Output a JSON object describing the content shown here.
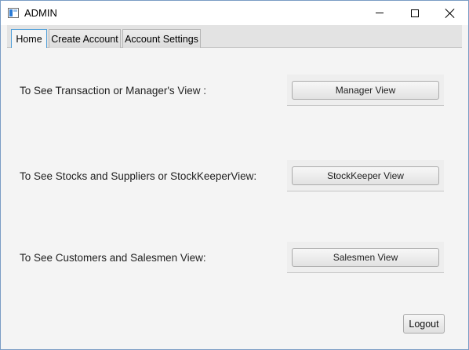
{
  "window": {
    "title": "ADMIN",
    "icon": "app-window-icon",
    "controls": {
      "minimize_icon": "minimize-icon",
      "maximize_icon": "maximize-icon",
      "close_icon": "close-icon"
    }
  },
  "tabs": [
    {
      "label": "Home",
      "selected": true
    },
    {
      "label": "Create Account",
      "selected": false
    },
    {
      "label": "Account Settings",
      "selected": false
    }
  ],
  "home": {
    "rows": [
      {
        "label": "To See Transaction or Manager's View :",
        "button": "Manager View"
      },
      {
        "label": "To See Stocks and Suppliers or StockKeeperView:",
        "button": "StockKeeper View"
      },
      {
        "label": "To See Customers and Salesmen View:",
        "button": "Salesmen View"
      }
    ],
    "logout_label": "Logout"
  },
  "colors": {
    "selected_tab_border": "#4e9ed8",
    "window_border": "#7a9cc4",
    "background": "#f4f4f4"
  }
}
